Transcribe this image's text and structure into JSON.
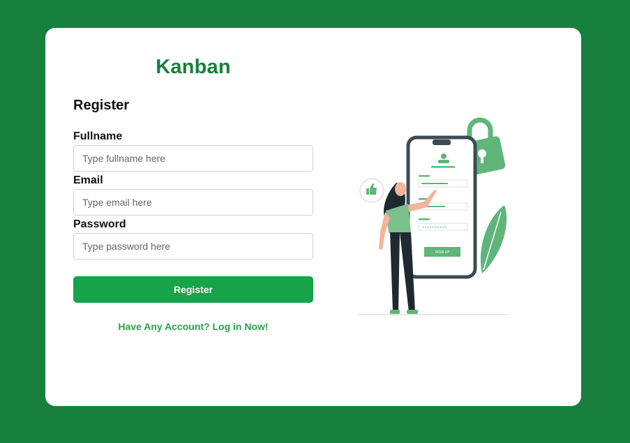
{
  "brand": {
    "name": "Kanban"
  },
  "form": {
    "title": "Register",
    "fields": [
      {
        "label": "Fullname",
        "placeholder": "Type fullname here",
        "value": ""
      },
      {
        "label": "Email",
        "placeholder": "Type email here",
        "value": ""
      },
      {
        "label": "Password",
        "placeholder": "Type password here",
        "value": ""
      }
    ],
    "submit_label": "Register",
    "login_link": "Have Any Account? Log in Now!"
  },
  "illustration": {
    "subject": "registration-illustration",
    "phone_button_text": "SIGN UP",
    "password_mask": "••••••••••"
  },
  "colors": {
    "background": "#17803d",
    "card": "#ffffff",
    "brand": "#17803d",
    "button": "#16a34a",
    "link": "#2e9e4d",
    "illustration_green": "#5fb57a"
  }
}
